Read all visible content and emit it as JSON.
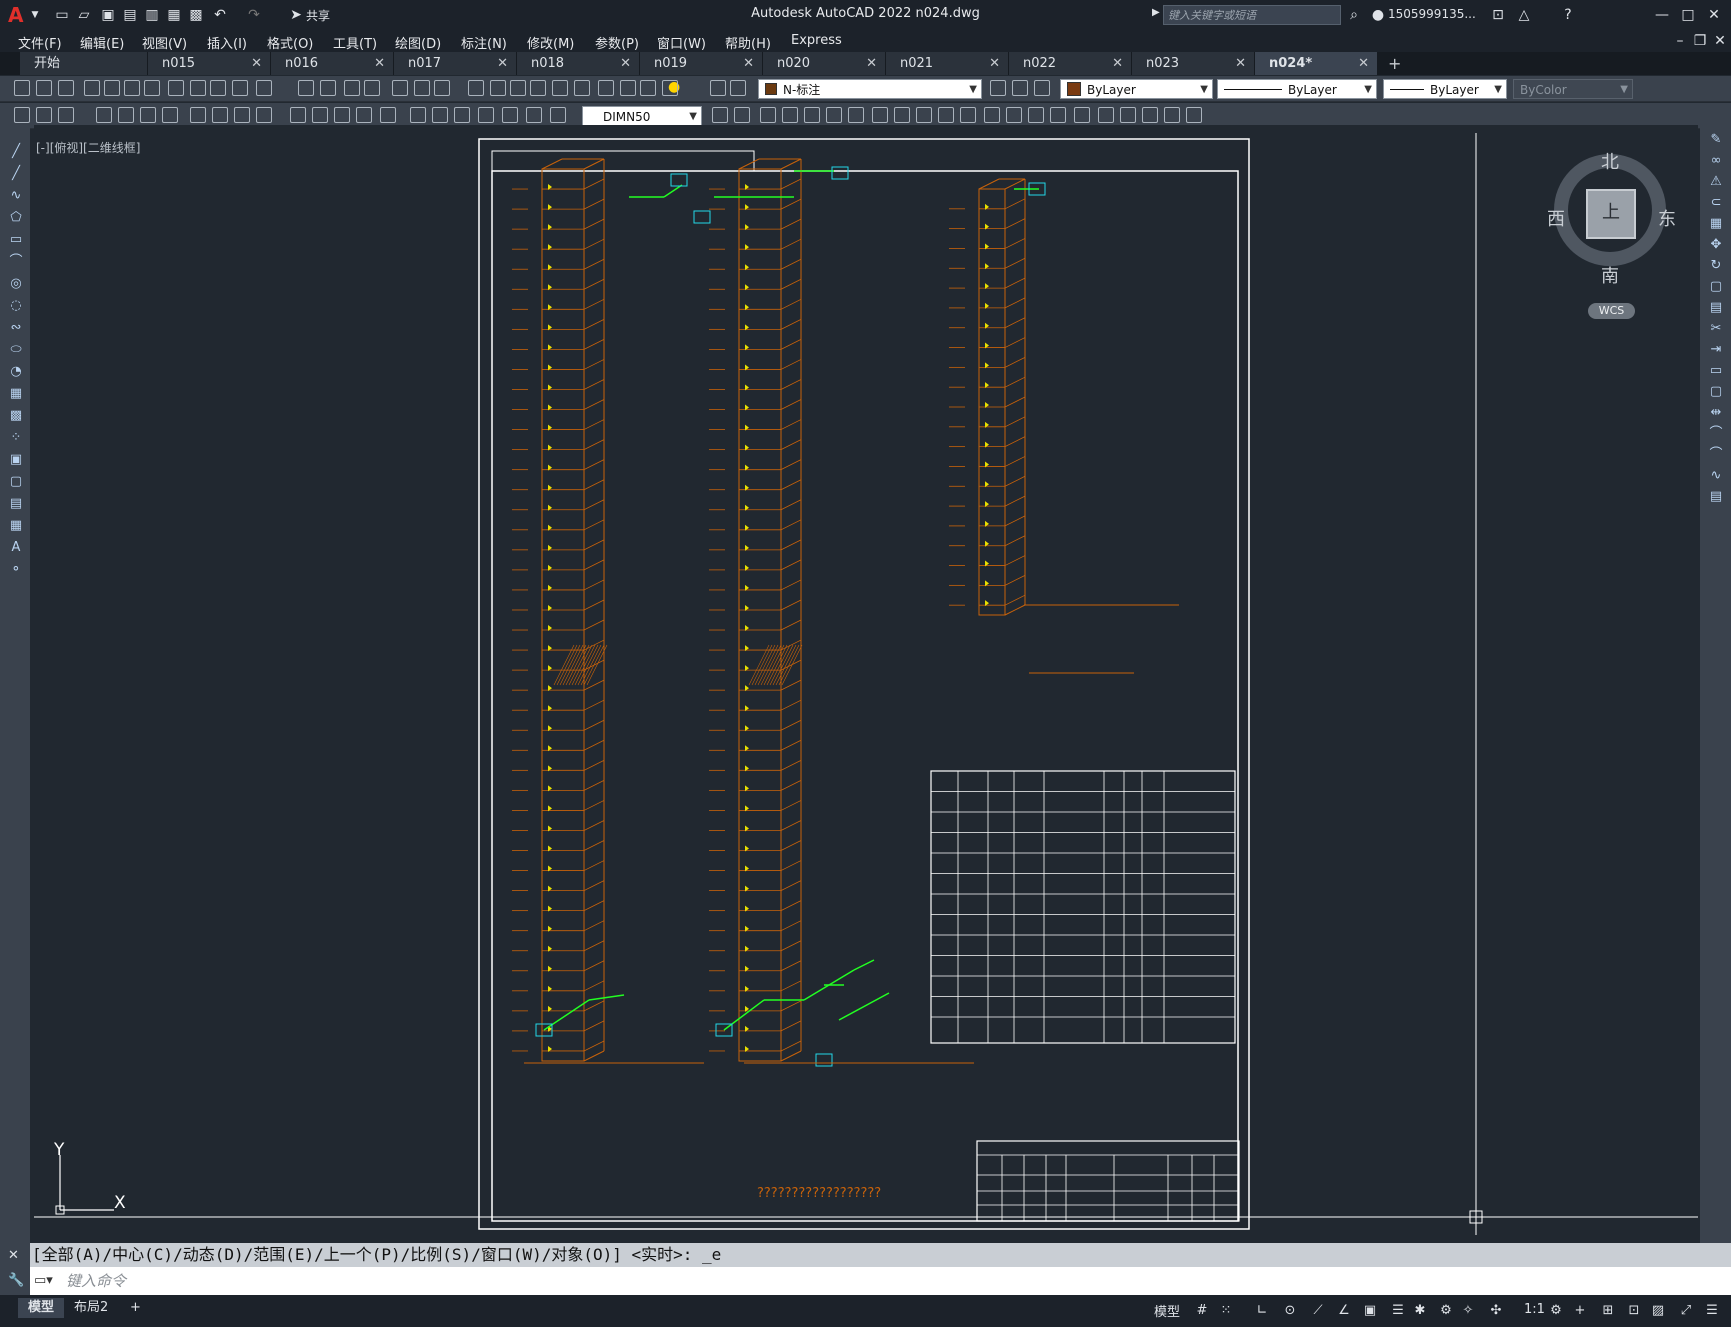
{
  "app": {
    "logo": "A",
    "title": "Autodesk AutoCAD 2022    n024.dwg",
    "search_placeholder": "键入关键字或短语",
    "user": "1505999135...",
    "share": "共享"
  },
  "menu": [
    "文件(F)",
    "编辑(E)",
    "视图(V)",
    "插入(I)",
    "格式(O)",
    "工具(T)",
    "绘图(D)",
    "标注(N)",
    "修改(M)",
    "参数(P)",
    "窗口(W)",
    "帮助(H)",
    "Express"
  ],
  "tabs": [
    {
      "label": "开始",
      "closable": false
    },
    {
      "label": "n015",
      "closable": true
    },
    {
      "label": "n016",
      "closable": true
    },
    {
      "label": "n017",
      "closable": true
    },
    {
      "label": "n018",
      "closable": true
    },
    {
      "label": "n019",
      "closable": true
    },
    {
      "label": "n020",
      "closable": true
    },
    {
      "label": "n021",
      "closable": true
    },
    {
      "label": "n022",
      "closable": true
    },
    {
      "label": "n023",
      "closable": true
    },
    {
      "label": "n024*",
      "closable": true,
      "active": true
    }
  ],
  "toolbar": {
    "layer": "N-标注",
    "color": "ByLayer",
    "linetype": "ByLayer",
    "lineweight": "ByLayer",
    "plotstyle": "ByColor",
    "dimstyle": "DIMN50"
  },
  "viewport": {
    "label": "[-][俯视][二维线框]",
    "compass": {
      "north": "北",
      "south": "南",
      "east": "东",
      "west": "西",
      "top": "上"
    },
    "wcs": "WCS",
    "ucs_x": "X",
    "ucs_y": "Y"
  },
  "drawing": {
    "caption_bottom": "??????????????????"
  },
  "command": {
    "history": "[全部(A)/中心(C)/动态(D)/范围(E)/上一个(P)/比例(S)/窗口(W)/对象(O)] <实时>: _e",
    "placeholder": "键入命令"
  },
  "status": {
    "tabs": [
      "模型",
      "布局2"
    ],
    "model": "模型",
    "scale": "1:1"
  },
  "colors": {
    "orange": "#c8620a",
    "yellow": "#e8e000",
    "green": "#22ff22",
    "cyan": "#22d8e8",
    "white": "#ffffff"
  }
}
